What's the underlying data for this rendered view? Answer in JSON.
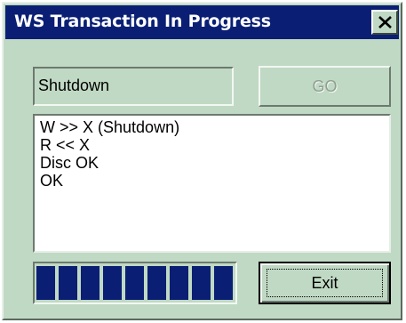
{
  "window": {
    "title": "WS Transaction In Progress",
    "close_icon": "close-x-icon"
  },
  "status": {
    "value": "Shutdown"
  },
  "go_button": {
    "label": "GO",
    "enabled": false
  },
  "log": {
    "lines": [
      "W >> X (Shutdown)",
      "R << X",
      "Disc OK",
      "OK"
    ]
  },
  "progress": {
    "fraction": 1.0
  },
  "exit_button": {
    "label": "Exit"
  },
  "colors": {
    "titlebar": "#0a1f74",
    "window_bg": "#c0d9c4",
    "progress_fill": "#0a1f74",
    "disabled_text": "#8f9f91"
  }
}
